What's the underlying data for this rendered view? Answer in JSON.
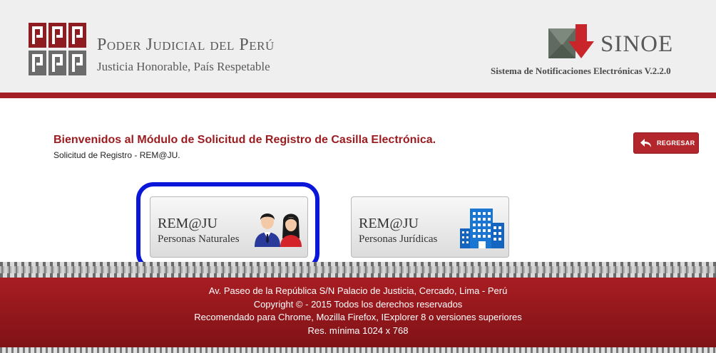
{
  "header": {
    "brand_title": "Poder Judicial del Perú",
    "brand_subtitle": "Justicia Honorable, País Respetable",
    "system_name": "SINOE",
    "system_subtitle": "Sistema de Notificaciones Electrónicas V.2.2.0"
  },
  "main": {
    "welcome_title": "Bienvenidos al Módulo de Solicitud de Registro de Casilla Electrónica.",
    "welcome_subtitle": "Solicitud de Registro - REM@JU.",
    "back_button_label": "REGRESAR",
    "options": [
      {
        "title": "REM@JU",
        "subtitle": "Personas Naturales",
        "icon": "people-icon"
      },
      {
        "title": "REM@JU",
        "subtitle": "Personas Jurídicas",
        "icon": "building-icon"
      }
    ]
  },
  "footer": {
    "address": "Av. Paseo de la República S/N Palacio de Justicia, Cercado, Lima - Perú",
    "copyright": "Copyright © - 2015 Todos los derechos reservados",
    "recommendation": "Recomendado para Chrome, Mozilla Firefox, IExplorer 8 o versiones superiores",
    "resolution": "Res. mínima 1024 x 768"
  },
  "colors": {
    "brand_red": "#a31f23",
    "highlight_blue": "#0a16d8",
    "icon_blue": "#1565c0"
  }
}
